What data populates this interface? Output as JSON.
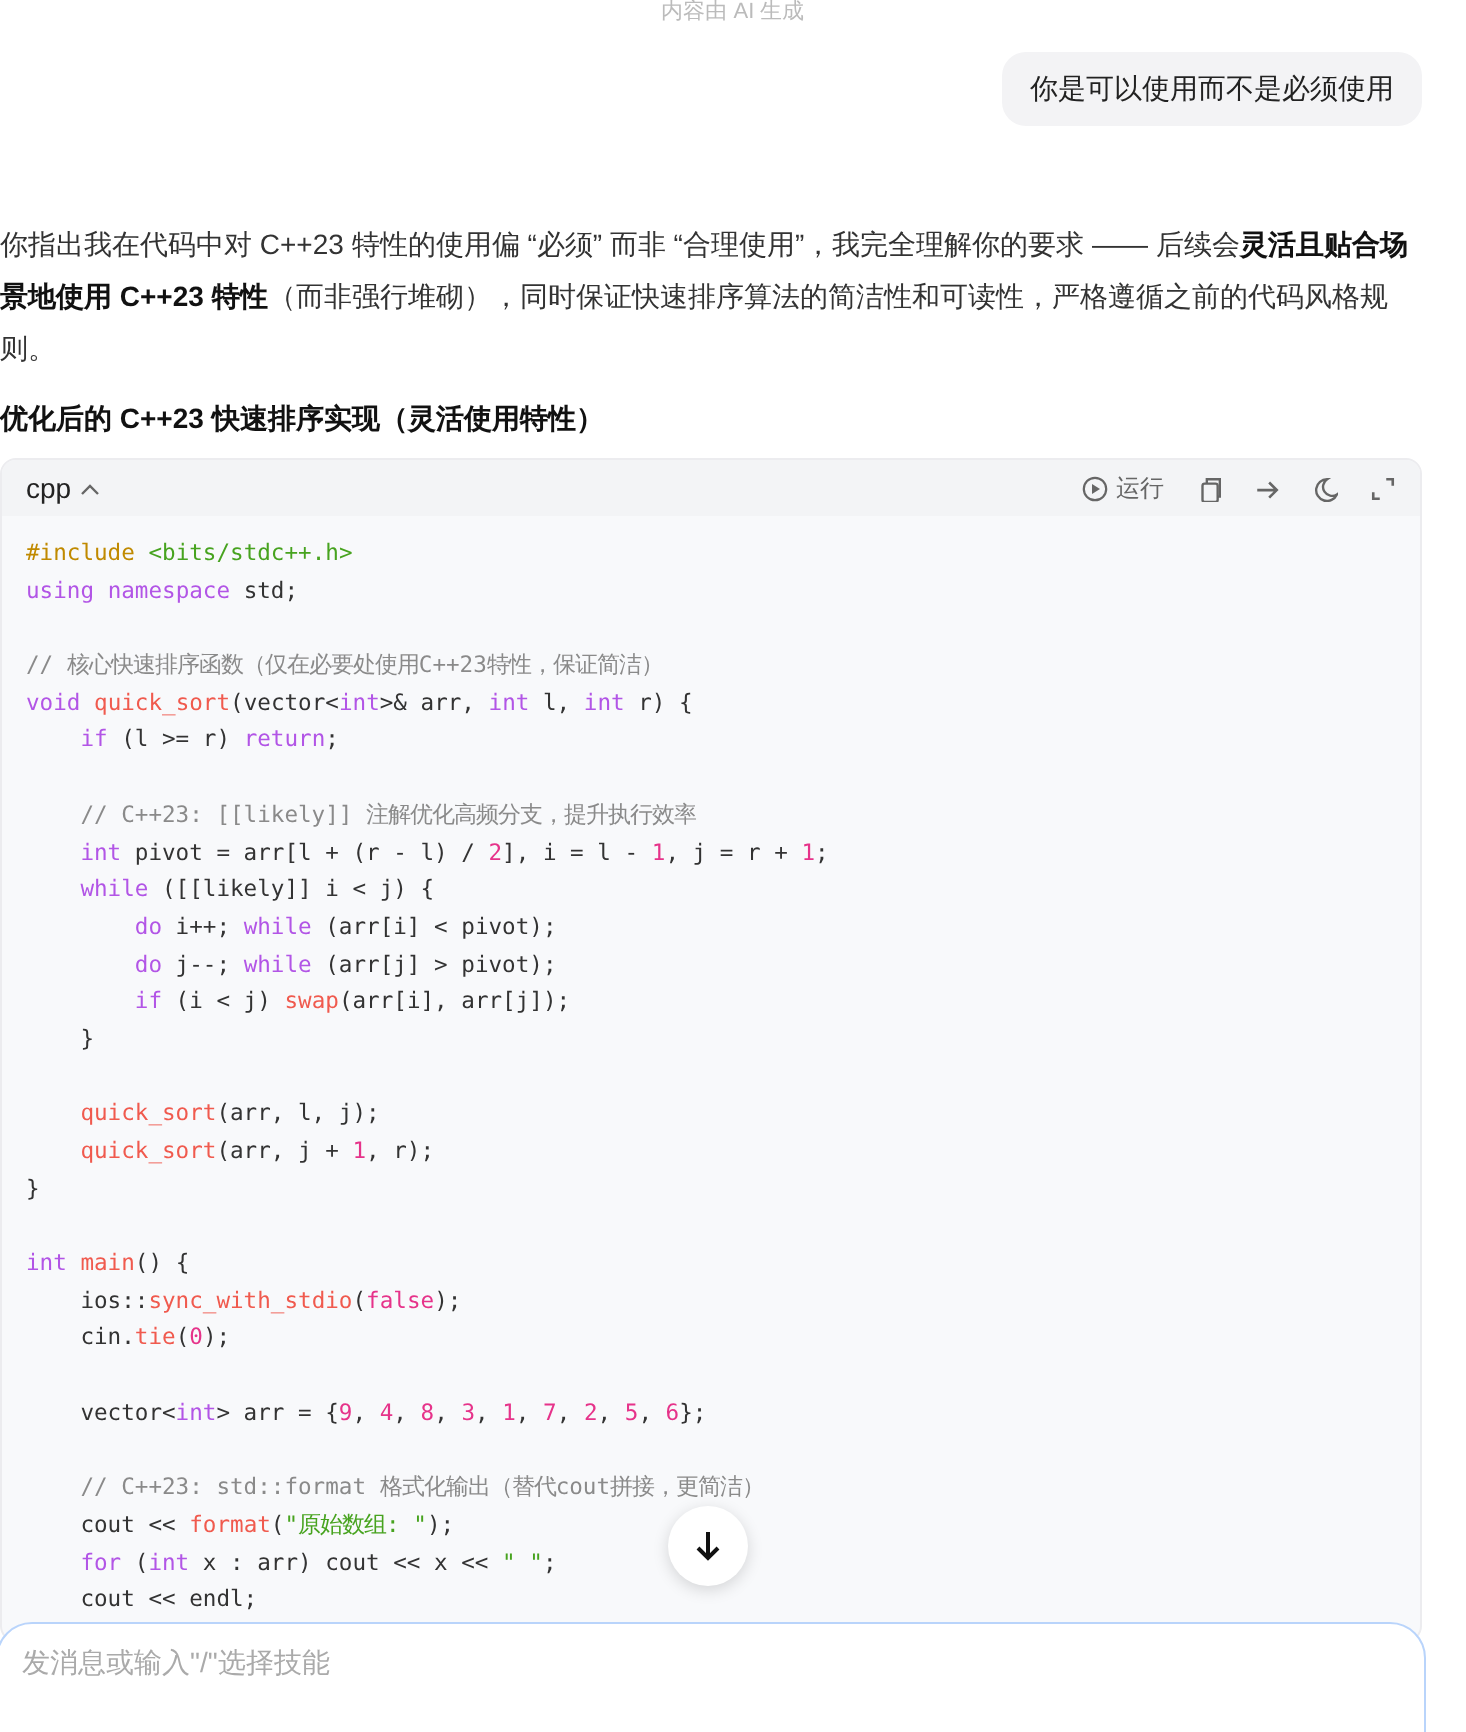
{
  "disclaimer": "内容由 AI 生成",
  "user_message": "你是可以使用而不是必须使用",
  "answer": {
    "paragraph": "你指出我在代码中对 C++23 特性的使用偏 “必须” 而非 “合理使用”，我完全理解你的要求 —— 后续会**灵活且贴合场景地使用 C++23 特性**（而非强行堆砌），同时保证快速排序算法的简洁性和可读性，严格遵循之前的代码风格规则。",
    "heading": "优化后的 C++23 快速排序实现（灵活使用特性）"
  },
  "code_block": {
    "language": "cpp",
    "run_label": "运行",
    "lines": [
      {
        "kind": "top",
        "tokens": [
          {
            "kind": "pre",
            "text": "#include"
          },
          {
            "kind": "str",
            "text": " <bits/stdc++.h>"
          }
        ]
      },
      {
        "kind": "top",
        "blank_after": true,
        "tokens": [
          {
            "kind": "kw",
            "text": "using"
          },
          {
            "kind": "kw",
            "text": " namespace"
          },
          {
            "kind": "p",
            "text": " std;"
          }
        ]
      },
      {
        "kind": "top",
        "tokens": [
          {
            "kind": "cmt",
            "text": "// 核心快速排序函数（仅在必要处使用C++23特性，保证简洁）"
          }
        ]
      },
      {
        "kind": "top",
        "tokens": [
          {
            "kind": "kw",
            "text": "void"
          },
          {
            "kind": "fn",
            "text": " quick_sort"
          },
          {
            "kind": "p",
            "text": "(vector<"
          },
          {
            "kind": "kw",
            "text": "int"
          },
          {
            "kind": "p",
            "text": ">& arr, "
          },
          {
            "kind": "kw",
            "text": "int"
          },
          {
            "kind": "p",
            "text": " l, "
          },
          {
            "kind": "kw",
            "text": "int"
          },
          {
            "kind": "p",
            "text": " r) {"
          }
        ]
      },
      {
        "kind": "inner",
        "blank_after": true,
        "tokens": [
          {
            "kind": "kw",
            "text": "if"
          },
          {
            "kind": "p",
            "text": " (l >= r) "
          },
          {
            "kind": "kw",
            "text": "return"
          },
          {
            "kind": "p",
            "text": ";"
          }
        ]
      },
      {
        "kind": "inner",
        "tokens": [
          {
            "kind": "cmt",
            "text": "// C++23: [[likely]] 注解优化高频分支，提升执行效率"
          }
        ]
      },
      {
        "kind": "inner",
        "tokens": [
          {
            "kind": "kw",
            "text": "int"
          },
          {
            "kind": "p",
            "text": " pivot = arr[l + (r - l) / "
          },
          {
            "kind": "num",
            "text": "2"
          },
          {
            "kind": "p",
            "text": "], i = l - "
          },
          {
            "kind": "num",
            "text": "1"
          },
          {
            "kind": "p",
            "text": ", j = r + "
          },
          {
            "kind": "num",
            "text": "1"
          },
          {
            "kind": "p",
            "text": ";"
          }
        ]
      },
      {
        "kind": "inner",
        "tokens": [
          {
            "kind": "kw",
            "text": "while"
          },
          {
            "kind": "p",
            "text": " ([[likely]] i < j) {"
          }
        ]
      },
      {
        "kind": "nested",
        "tokens": [
          {
            "kind": "kw",
            "text": "do"
          },
          {
            "kind": "p",
            "text": " i++; "
          },
          {
            "kind": "kw",
            "text": "while"
          },
          {
            "kind": "p",
            "text": " (arr[i] < pivot);"
          }
        ]
      },
      {
        "kind": "nested",
        "tokens": [
          {
            "kind": "kw",
            "text": "do"
          },
          {
            "kind": "p",
            "text": " j--; "
          },
          {
            "kind": "kw",
            "text": "while"
          },
          {
            "kind": "p",
            "text": " (arr[j] > pivot);"
          }
        ]
      },
      {
        "kind": "nested",
        "tokens": [
          {
            "kind": "kw",
            "text": "if"
          },
          {
            "kind": "p",
            "text": " (i < j) "
          },
          {
            "kind": "fn",
            "text": "swap"
          },
          {
            "kind": "p",
            "text": "(arr[i], arr[j]);"
          }
        ]
      },
      {
        "kind": "inner",
        "blank_after": true,
        "tokens": [
          {
            "kind": "p",
            "text": "}"
          }
        ]
      },
      {
        "kind": "inner",
        "tokens": [
          {
            "kind": "fn",
            "text": "quick_sort"
          },
          {
            "kind": "p",
            "text": "(arr, l, j);"
          }
        ]
      },
      {
        "kind": "inner",
        "tokens": [
          {
            "kind": "fn",
            "text": "quick_sort"
          },
          {
            "kind": "p",
            "text": "(arr, j + "
          },
          {
            "kind": "num",
            "text": "1"
          },
          {
            "kind": "p",
            "text": ", r);"
          }
        ]
      },
      {
        "kind": "top",
        "blank_after": true,
        "tokens": [
          {
            "kind": "p",
            "text": "}"
          }
        ]
      },
      {
        "kind": "top",
        "tokens": [
          {
            "kind": "kw",
            "text": "int"
          },
          {
            "kind": "fn",
            "text": " main"
          },
          {
            "kind": "p",
            "text": "() {"
          }
        ]
      },
      {
        "kind": "inner",
        "tokens": [
          {
            "kind": "p",
            "text": "ios::"
          },
          {
            "kind": "fn",
            "text": "sync_with_stdio"
          },
          {
            "kind": "p",
            "text": "("
          },
          {
            "kind": "num",
            "text": "false"
          },
          {
            "kind": "p",
            "text": ");"
          }
        ]
      },
      {
        "kind": "inner",
        "blank_after": true,
        "tokens": [
          {
            "kind": "p",
            "text": "cin."
          },
          {
            "kind": "fn",
            "text": "tie"
          },
          {
            "kind": "p",
            "text": "("
          },
          {
            "kind": "num",
            "text": "0"
          },
          {
            "kind": "p",
            "text": ");"
          }
        ]
      },
      {
        "kind": "inner",
        "blank_after": true,
        "tokens": [
          {
            "kind": "p",
            "text": "vector<"
          },
          {
            "kind": "kw",
            "text": "int"
          },
          {
            "kind": "p",
            "text": "> arr = {"
          },
          {
            "kind": "num",
            "text": "9"
          },
          {
            "kind": "p",
            "text": ", "
          },
          {
            "kind": "num",
            "text": "4"
          },
          {
            "kind": "p",
            "text": ", "
          },
          {
            "kind": "num",
            "text": "8"
          },
          {
            "kind": "p",
            "text": ", "
          },
          {
            "kind": "num",
            "text": "3"
          },
          {
            "kind": "p",
            "text": ", "
          },
          {
            "kind": "num",
            "text": "1"
          },
          {
            "kind": "p",
            "text": ", "
          },
          {
            "kind": "num",
            "text": "7"
          },
          {
            "kind": "p",
            "text": ", "
          },
          {
            "kind": "num",
            "text": "2"
          },
          {
            "kind": "p",
            "text": ", "
          },
          {
            "kind": "num",
            "text": "5"
          },
          {
            "kind": "p",
            "text": ", "
          },
          {
            "kind": "num",
            "text": "6"
          },
          {
            "kind": "p",
            "text": "};"
          }
        ]
      },
      {
        "kind": "inner",
        "tokens": [
          {
            "kind": "cmt",
            "text": "// C++23: std::format 格式化输出（替代cout拼接，更简洁）"
          }
        ]
      },
      {
        "kind": "inner",
        "tokens": [
          {
            "kind": "p",
            "text": "cout << "
          },
          {
            "kind": "fn",
            "text": "format"
          },
          {
            "kind": "p",
            "text": "("
          },
          {
            "kind": "str",
            "text": "\"原始数组: \""
          },
          {
            "kind": "p",
            "text": ");"
          }
        ]
      },
      {
        "kind": "inner",
        "tokens": [
          {
            "kind": "kw",
            "text": "for"
          },
          {
            "kind": "p",
            "text": " ("
          },
          {
            "kind": "kw",
            "text": "int"
          },
          {
            "kind": "p",
            "text": " x : arr) cout << x << "
          },
          {
            "kind": "str",
            "text": "\" \""
          },
          {
            "kind": "p",
            "text": ";"
          }
        ]
      },
      {
        "kind": "inner",
        "tokens": [
          {
            "kind": "p",
            "text": "cout << endl;"
          }
        ]
      }
    ]
  },
  "input": {
    "placeholder": "发消息或输入\"/\"选择技能"
  }
}
